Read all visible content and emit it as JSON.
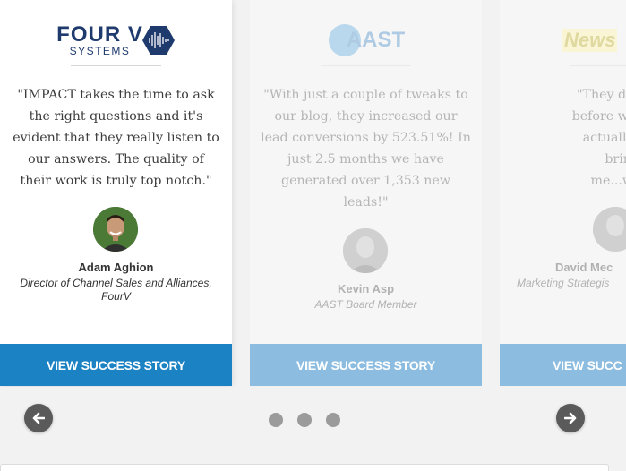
{
  "cards": [
    {
      "logo_text_main": "FOUR V",
      "logo_text_sub": "SYSTEMS",
      "quote": "\"IMPACT takes the time to ask the right questions and it's evident that they really listen to our answers. The quality of their work is truly top notch.\"",
      "name": "Adam Aghion",
      "title": "Director of Channel Sales and Alliances, FourV",
      "cta": "VIEW SUCCESS STORY"
    },
    {
      "logo_text_main": "AAST",
      "quote": "\"With just a couple of tweaks to our blog, they increased our lead conversions by 523.51%! In just 2.5 months we have generated over 1,353 new leads!\"",
      "name": "Kevin Asp",
      "title": "AAST Board Member",
      "cta": "VIEW SUCCESS STORY"
    },
    {
      "logo_text_main": "News",
      "quote_lines": [
        "\"They did a fan",
        "before we finish",
        "actually sold s",
        "bringing m",
        "me...which w"
      ],
      "name": "David Mec",
      "title": "Marketing Strategis",
      "cta": "VIEW SUCC"
    }
  ],
  "nav": {
    "prev_icon": "arrow-left-icon",
    "next_icon": "arrow-right-icon"
  },
  "pagination": {
    "count": 3
  },
  "colors": {
    "cta_active": "#1b82c4",
    "cta_inactive": "#8cbde0",
    "brand_navy": "#1f3b6e"
  }
}
